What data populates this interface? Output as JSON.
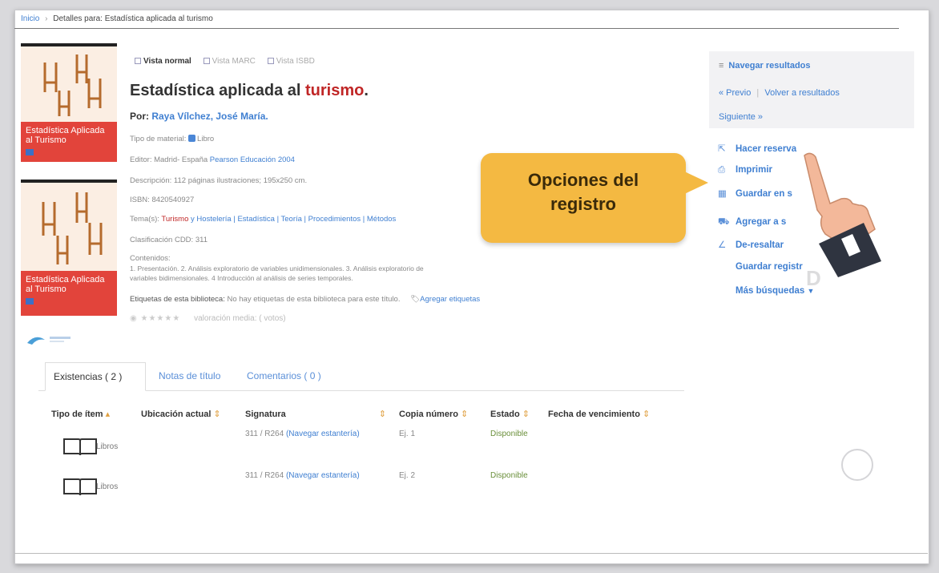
{
  "breadcrumb": {
    "home": "Inicio",
    "current": "Detalles para: Estadística aplicada al turismo"
  },
  "view_tabs": {
    "normal": "Vista normal",
    "marc": "Vista MARC",
    "isbd": "Vista ISBD"
  },
  "record": {
    "title_main": "Estadística aplicada al ",
    "title_highlight": "turismo",
    "title_end": ".",
    "author_label": "Por: ",
    "author": "Raya Vílchez, José María.",
    "material_label": "Tipo de material: ",
    "material_value": "Libro",
    "publisher_label": "Editor: Madrid- España ",
    "publisher_value": "Pearson Educación 2004",
    "description": "Descripción: 112 páginas ilustraciones; 195x250 cm.",
    "isbn": "ISBN: 8420540927",
    "topics_label": "Tema(s): ",
    "topic_first": "Turismo",
    "topics_rest": " y Hostelería | Estadística | Teoría | Procedimientos | Métodos",
    "cdd": "Clasificación CDD: 311",
    "contents_label": "Contenidos:",
    "contents_line1": "1. Presentación. 2. Análisis exploratorio de variables unidimensionales. 3. Análisis exploratorio de",
    "contents_line2": "variables bidimensionales. 4 Introducción al análisis de series temporales.",
    "tags_label": "Etiquetas de esta biblioteca: ",
    "tags_value": "No hay etiquetas de esta biblioteca para este título.",
    "add_tags": "Agregar etiquetas",
    "rating_text": "valoración media: ( votos)"
  },
  "covers": {
    "cover_title": "Estadística Aplicada al Turismo"
  },
  "callout": {
    "line1": "Opciones del",
    "line2": "registro"
  },
  "nav_results": {
    "header": "Navegar resultados",
    "prev": "« Previo",
    "back": "Volver a resultados",
    "next": "Siguiente »"
  },
  "record_options": [
    {
      "label": "Hacer reserva",
      "icon": "reserve-icon"
    },
    {
      "label": "Imprimir",
      "icon": "print-icon"
    },
    {
      "label": "Guardar en s",
      "icon": "save-icon"
    },
    {
      "label": "Agregar a s",
      "icon": "cart-icon"
    },
    {
      "label": "De-resaltar",
      "icon": "unhighlight-icon"
    },
    {
      "label": "Guardar registr",
      "icon": ""
    },
    {
      "label": "Más búsquedas",
      "icon": "caret-down-icon"
    }
  ],
  "bottom_tabs": {
    "holdings": "Existencias ( 2 )",
    "notes": "Notas de título",
    "comments": "Comentarios ( 0 )"
  },
  "table": {
    "headers": [
      "Tipo de ítem",
      "Ubicación actual",
      "Signatura",
      "Copia número",
      "Estado",
      "Fecha de vencimiento"
    ],
    "rows": [
      {
        "type": "Libros",
        "call": "311 / R264",
        "browse": "(Navegar estantería)",
        "copy": "Ej. 1",
        "status": "Disponible"
      },
      {
        "type": "Libros",
        "call": "311 / R264",
        "browse": "(Navegar estantería)",
        "copy": "Ej. 2",
        "status": "Disponible"
      }
    ]
  },
  "colors": {
    "link": "#3f7fd1",
    "highlight": "#c02626",
    "callout": "#f4b942",
    "cover_band": "#e2443b"
  }
}
